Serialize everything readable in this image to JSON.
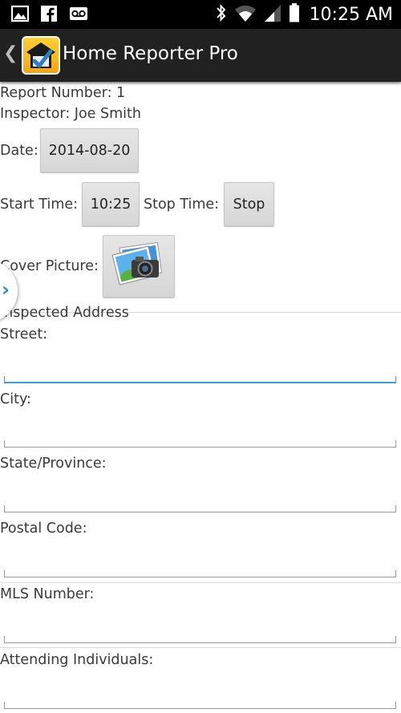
{
  "status_bar": {
    "time": "10:25 AM",
    "icons": [
      "gallery-icon",
      "facebook-icon",
      "voicemail-icon",
      "bluetooth-icon",
      "wifi-icon",
      "signal-icon",
      "battery-icon"
    ]
  },
  "action_bar": {
    "back_glyph": "❮",
    "title": "Home Reporter Pro"
  },
  "report": {
    "number_label": "Report Number: 1",
    "inspector_label": "Inspector: Joe Smith",
    "date_label": "Date:",
    "date_value": "2014-08-20",
    "start_time_label": "Start Time:",
    "start_time_value": "10:25",
    "stop_time_label": "Stop Time:",
    "stop_button": "Stop",
    "cover_picture_label": "Cover Picture:"
  },
  "address": {
    "section_title": "Inspected Address",
    "street_label": "Street:",
    "street_value": "",
    "city_label": "City:",
    "city_value": "",
    "state_label": "State/Province:",
    "state_value": "",
    "postal_label": "Postal Code:",
    "postal_value": "",
    "mls_label": "MLS Number:",
    "mls_value": "",
    "attending_label": "Attending Individuals:",
    "attending_value": ""
  },
  "colors": {
    "accent": "#3a9fd6",
    "action_bar": "#212121",
    "status_bar": "#000000"
  }
}
